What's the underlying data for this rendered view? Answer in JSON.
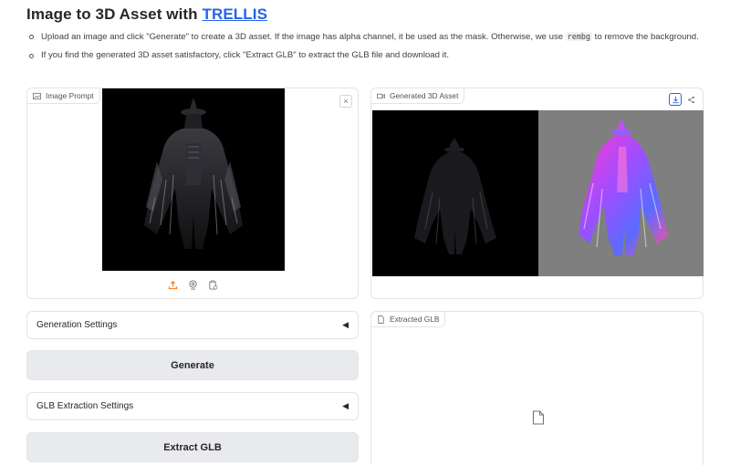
{
  "header": {
    "title_prefix": "Image to 3D Asset with ",
    "title_link": "TRELLIS"
  },
  "instructions": {
    "item1_before": "Upload an image and click \"Generate\" to create a 3D asset. If the image has alpha channel, it be used as the mask. Otherwise, we use ",
    "item1_code": "rembg",
    "item1_after": " to remove the background.",
    "item2": "If you find the generated 3D asset satisfactory, click \"Extract GLB\" to extract the GLB file and download it."
  },
  "image_prompt": {
    "label": "Image Prompt",
    "close": "×",
    "tools": [
      "upload-icon",
      "webcam-icon",
      "clipboard-icon"
    ]
  },
  "generated_asset": {
    "label": "Generated 3D Asset",
    "tools": [
      "download-icon",
      "share-icon"
    ]
  },
  "generation_settings": {
    "label": "Generation Settings",
    "caret": "◀"
  },
  "generate_button": {
    "label": "Generate"
  },
  "glb_settings": {
    "label": "GLB Extraction Settings",
    "caret": "◀"
  },
  "extract_button": {
    "label": "Extract GLB"
  },
  "extracted_glb": {
    "label": "Extracted GLB"
  },
  "colors": {
    "accent": "#2563eb",
    "button_bg": "#e9eaee",
    "border": "#e4e4e7",
    "render_bg": "#7f7f7f"
  }
}
